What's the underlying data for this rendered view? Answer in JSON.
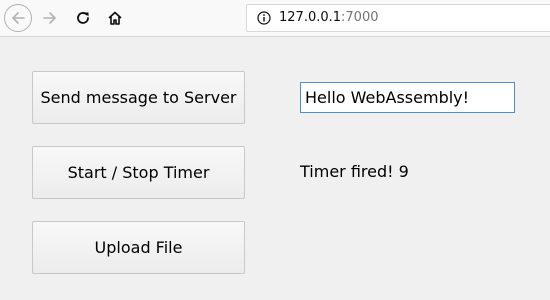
{
  "browser": {
    "url_host": "127.0.0.1",
    "url_port": ":7000",
    "icons": {
      "back": "back-arrow-icon",
      "forward": "forward-arrow-icon",
      "reload": "reload-icon",
      "home": "home-icon",
      "info": "info-icon"
    }
  },
  "page": {
    "send_button_label": "Send message to Server",
    "timer_button_label": "Start / Stop Timer",
    "upload_button_label": "Upload File",
    "message_input_value": "Hello WebAssembly!",
    "timer_status": "Timer fired! 9"
  },
  "colors": {
    "background": "#f0f0f0",
    "input_focus_border": "#4a90d9"
  }
}
